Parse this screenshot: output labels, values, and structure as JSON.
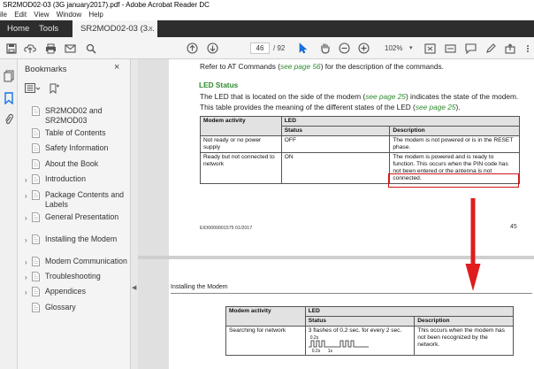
{
  "window": {
    "title": "SR2MOD02-03 (3G january2017).pdf - Adobe Acrobat Reader DC"
  },
  "menu": [
    "ile",
    "Edit",
    "View",
    "Window",
    "Help"
  ],
  "tabs": {
    "home": "Home",
    "tools": "Tools",
    "doc": "SR2MOD02-03 (3...",
    "doc_close": "×"
  },
  "toolbar": {
    "page_current": "46",
    "page_total": "/ 92",
    "zoom": "102%",
    "zoom_dropdown": "▾",
    "icons": [
      "save-icon",
      "upload-icon",
      "print-icon",
      "email-icon",
      "search-icon",
      "prev-page-icon",
      "next-page-icon",
      "select-cursor-icon",
      "hand-icon",
      "zoom-out-icon",
      "zoom-in-icon",
      "marquee-zoom-icon",
      "fit-page-icon",
      "comment-icon",
      "draw-icon",
      "share-icon",
      "more-icon"
    ]
  },
  "bookmarks": {
    "title": "Bookmarks",
    "close": "×",
    "items": [
      {
        "label": "SR2MOD02 and SR2MOD03",
        "expandable": false
      },
      {
        "label": "Table of Contents",
        "expandable": false
      },
      {
        "label": "Safety Information",
        "expandable": false
      },
      {
        "label": "About the Book",
        "expandable": false
      },
      {
        "label": "Introduction",
        "expandable": true
      },
      {
        "label": "Package Contents and Labels",
        "expandable": true
      },
      {
        "label": "General Presentation",
        "expandable": true
      },
      {
        "label": "Installing the Modem",
        "expandable": true
      },
      {
        "label": "Modem Communication",
        "expandable": true
      },
      {
        "label": "Troubleshooting",
        "expandable": true
      },
      {
        "label": "Appendices",
        "expandable": true
      },
      {
        "label": "Glossary",
        "expandable": false
      }
    ],
    "chevron": "›"
  },
  "splitter": {
    "arrow": "◀"
  },
  "page1": {
    "intro_pre": "Refer to AT Commands (",
    "intro_link": "see page 56",
    "intro_post": ") for the description of the commands.",
    "heading": "LED Status",
    "line1_pre": "The LED that is located on the side of the modem (",
    "line1_link": "see page 25",
    "line1_post": ") indicates the state of the modem.",
    "line2_pre": "This table provides the meaning of the different states of the LED (",
    "line2_link": "see page 25",
    "line2_post": ").",
    "table": {
      "col_activity": "Modem activity",
      "col_led": "LED",
      "col_status": "Status",
      "col_description": "Description",
      "rows": [
        {
          "activity": "Not ready or no power supply",
          "status": "OFF",
          "description": "The modem is not powered or is in the RESET phase."
        },
        {
          "activity": "Ready but not connected to network",
          "status": "ON",
          "description": "The modem is powered and is ready to function. This occurs when the PIN code has not been entered or the antenna is not connected."
        }
      ]
    },
    "footer_code": "EIO0000001575 01/2017",
    "footer_page": "45"
  },
  "page2": {
    "running_header": "Installing the Modem",
    "table": {
      "col_activity": "Modem activity",
      "col_led": "LED",
      "col_status": "Status",
      "col_description": "Description",
      "rows": [
        {
          "activity": "Searching for network",
          "status": "3 flashes of 0,2 sec. for every 2 sec.",
          "waveform_top": "0.2s",
          "waveform_bottom1": "0.2s",
          "waveform_bottom2": "1s",
          "description": "This occurs when the modem has not been recognized by the network."
        }
      ]
    }
  },
  "colors": {
    "accent_green": "#2e8b2e",
    "highlight_red": "#d01818",
    "tab_dark": "#2d2d2d",
    "bookmark_blue": "#1473e6"
  }
}
